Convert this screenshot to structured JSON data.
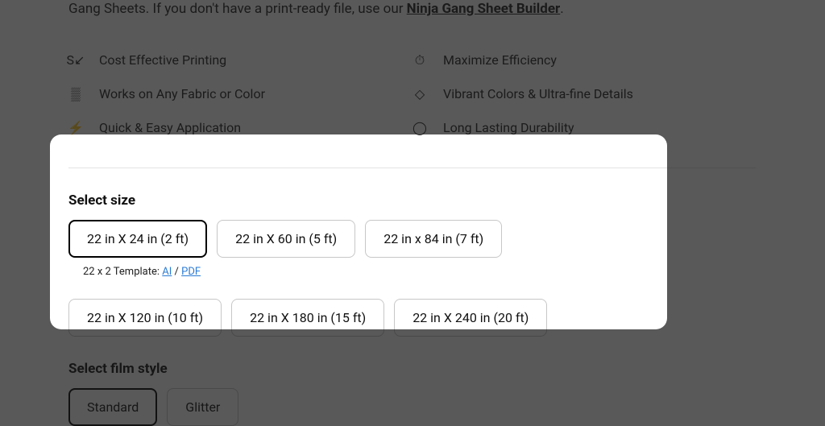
{
  "intro": {
    "prefix": "Gang Sheets. If you don't have a print-ready file, use our ",
    "link": "Ninja Gang Sheet Builder",
    "suffix": "."
  },
  "features": {
    "left": [
      {
        "icon": "cost-icon",
        "glyph": "S↙",
        "label": "Cost Effective Printing"
      },
      {
        "icon": "grid-icon",
        "glyph": "▒",
        "label": "Works on Any Fabric or Color"
      },
      {
        "icon": "bolt-icon",
        "glyph": "⚡",
        "label": "Quick & Easy Application"
      }
    ],
    "right": [
      {
        "icon": "clock-icon",
        "glyph": "⏱",
        "label": "Maximize Efficiency"
      },
      {
        "icon": "drop-icon",
        "glyph": "◇",
        "label": "Vibrant Colors & Ultra-fine Details"
      },
      {
        "icon": "shield-icon",
        "glyph": "◯",
        "label": "Long Lasting Durability"
      }
    ]
  },
  "size": {
    "title": "Select size",
    "options": [
      {
        "label": "22 in X 24 in (2 ft)",
        "selected": true
      },
      {
        "label": "22 in X 60 in (5 ft)",
        "selected": false
      },
      {
        "label": "22 in x 84 in (7 ft)",
        "selected": false
      },
      {
        "label": "22 in X 120 in (10 ft)",
        "selected": false
      },
      {
        "label": "22 in X 180 in (15 ft)",
        "selected": false
      },
      {
        "label": "22 in X 240 in (20 ft)",
        "selected": false
      }
    ],
    "template": {
      "prefix": "22 x 2 Template: ",
      "ai": "AI",
      "sep": " / ",
      "pdf": "PDF"
    }
  },
  "film": {
    "title": "Select film style",
    "options": [
      {
        "label": "Standard",
        "selected": true
      },
      {
        "label": "Glitter",
        "selected": false
      }
    ]
  }
}
